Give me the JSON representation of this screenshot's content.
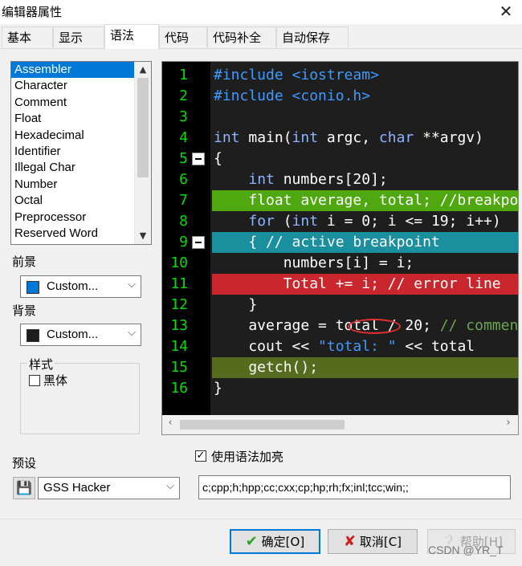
{
  "window": {
    "title": "编辑器属性",
    "close_icon": "close-icon"
  },
  "tabs": [
    {
      "label": "基本",
      "active": false
    },
    {
      "label": "显示",
      "active": false
    },
    {
      "label": "语法",
      "active": true
    },
    {
      "label": "代码",
      "active": false
    },
    {
      "label": "代码补全",
      "active": false
    },
    {
      "label": "自动保存",
      "active": false
    }
  ],
  "syntax_list": {
    "items": [
      "Assembler",
      "Character",
      "Comment",
      "Float",
      "Hexadecimal",
      "Identifier",
      "Illegal Char",
      "Number",
      "Octal",
      "Preprocessor",
      "Reserved Word"
    ],
    "selected": "Assembler"
  },
  "foreground": {
    "label": "前景",
    "value": "Custom...",
    "color": "#0078d7"
  },
  "background": {
    "label": "背景",
    "value": "Custom...",
    "color": "#1e1e1e"
  },
  "style_group": {
    "label": "样式",
    "bold_label": "黑体",
    "bold_checked": false
  },
  "editor": {
    "lines": [
      {
        "num": "1",
        "tokens": [
          [
            "pp",
            "#include <iostream>"
          ]
        ]
      },
      {
        "num": "2",
        "tokens": [
          [
            "pp",
            "#include <conio.h>"
          ]
        ]
      },
      {
        "num": "3",
        "tokens": []
      },
      {
        "num": "4",
        "tokens": [
          [
            "ty",
            "int"
          ],
          [
            "nm",
            " main("
          ],
          [
            "ty",
            "int"
          ],
          [
            "nm",
            " argc, "
          ],
          [
            "ty",
            "char"
          ],
          [
            "nm",
            " **argv)"
          ]
        ]
      },
      {
        "num": "5",
        "fold": true,
        "tokens": [
          [
            "nm",
            "{"
          ]
        ]
      },
      {
        "num": "6",
        "tokens": [
          [
            "nm",
            "    "
          ],
          [
            "ty",
            "int"
          ],
          [
            "nm",
            " numbers[20];"
          ]
        ]
      },
      {
        "num": "7",
        "highlight": "#4fa80f",
        "tokens": [
          [
            "nm",
            "    float average, total; //breakpoint"
          ]
        ]
      },
      {
        "num": "8",
        "tokens": [
          [
            "nm",
            "    "
          ],
          [
            "kw",
            "for"
          ],
          [
            "nm",
            " ("
          ],
          [
            "ty",
            "int"
          ],
          [
            "nm",
            " i = 0; i <= 19; i++)"
          ]
        ]
      },
      {
        "num": "9",
        "fold": true,
        "highlight": "#1a8f9e",
        "tokens": [
          [
            "nm",
            "    { // active breakpoint"
          ]
        ]
      },
      {
        "num": "10",
        "tokens": [
          [
            "nm",
            "        numbers[i] = i;"
          ]
        ]
      },
      {
        "num": "11",
        "highlight": "#c9262e",
        "tokens": [
          [
            "nm",
            "        Total += i; // error line"
          ]
        ]
      },
      {
        "num": "12",
        "tokens": [
          [
            "nm",
            "    }"
          ]
        ]
      },
      {
        "num": "13",
        "ellipse": true,
        "tokens": [
          [
            "nm",
            "    average = total / 20; "
          ],
          [
            "cm",
            "// comment"
          ]
        ]
      },
      {
        "num": "14",
        "tokens": [
          [
            "nm",
            "    cout << "
          ],
          [
            "str",
            "\"total: \""
          ],
          [
            "nm",
            " << total"
          ]
        ]
      },
      {
        "num": "15",
        "highlight": "#566b1e",
        "tokens": [
          [
            "nm",
            "    getch();"
          ]
        ]
      },
      {
        "num": "16",
        "tokens": [
          [
            "nm",
            "}"
          ]
        ]
      }
    ]
  },
  "syntax_highlight": {
    "label": "使用语法加亮",
    "checked": true
  },
  "preset": {
    "label": "预设",
    "value": "GSS Hacker",
    "icon": "floppy-icon"
  },
  "extensions": {
    "value": "c;cpp;h;hpp;cc;cxx;cp;hp;rh;fx;inl;tcc;win;;"
  },
  "buttons": {
    "ok": "确定[O]",
    "cancel": "取消[C]",
    "help": "帮助[H]"
  },
  "watermark": "CSDN @YR_T"
}
